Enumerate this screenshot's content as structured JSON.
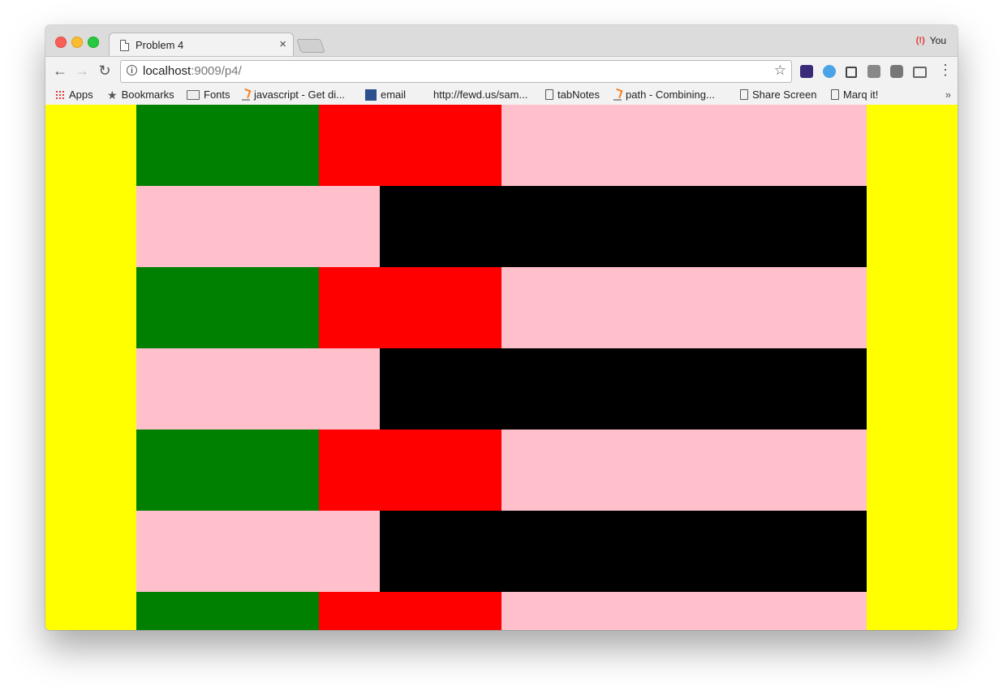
{
  "window": {
    "tab": {
      "title": "Problem 4",
      "close": "×"
    },
    "profile": {
      "label": "You"
    }
  },
  "toolbar": {
    "back": "←",
    "forward": "→",
    "reload": "↻",
    "info": "i",
    "url_host": "localhost",
    "url_rest": ":9009/p4/",
    "star": "☆",
    "menu": "⋮",
    "extensions": [
      "pixel-ruler-icon",
      "vimeo-icon",
      "puzzle-icon",
      "tag-icon",
      "pocket-icon",
      "cast-icon"
    ]
  },
  "bookmarks": [
    {
      "label": "Apps",
      "icon": "apps-grid-icon"
    },
    {
      "label": "Bookmarks",
      "icon": "star-icon"
    },
    {
      "label": "Fonts",
      "icon": "folder-icon"
    },
    {
      "label": "javascript - Get di...",
      "icon": "stackoverflow-icon"
    },
    {
      "label": "email",
      "icon": "grid-icon"
    },
    {
      "label": "http://fewd.us/sam...",
      "icon": ""
    },
    {
      "label": "tabNotes",
      "icon": "document-icon"
    },
    {
      "label": "path - Combining...",
      "icon": "stackoverflow-icon"
    },
    {
      "label": "Share Screen",
      "icon": "document-icon"
    },
    {
      "label": "Marq it!",
      "icon": "document-icon"
    }
  ],
  "bookmarks_overflow": "»",
  "page": {
    "background": "#ffff00",
    "colors": {
      "green": "#008000",
      "red": "#ff0000",
      "pink": "#ffc0cb",
      "black": "#000000"
    },
    "pattern": [
      [
        {
          "color": "green",
          "fraction": 0.25
        },
        {
          "color": "red",
          "fraction": 0.25
        },
        {
          "color": "pink",
          "fraction": 0.5
        }
      ],
      [
        {
          "color": "pink",
          "fraction": 0.3333
        },
        {
          "color": "black",
          "fraction": 0.6667
        }
      ]
    ],
    "rows": 7
  }
}
